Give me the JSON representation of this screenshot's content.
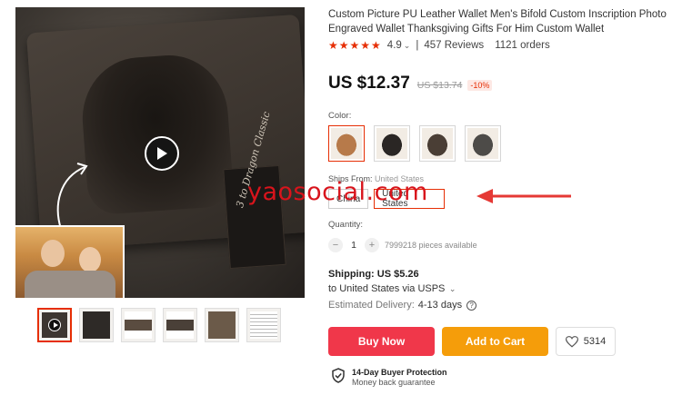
{
  "product": {
    "title": "Custom Picture PU Leather Wallet Men's Bifold Custom Inscription Photo Engraved Wallet Thanksgiving Gifts For Him Custom Wallet",
    "stars": "★★★★★",
    "rating": "4.9",
    "reviews": "457 Reviews",
    "orders": "1121 orders",
    "price": "US $12.37",
    "old_price": "US $13.74",
    "discount": "-10%"
  },
  "gallery": {
    "wallet_tag_text": "3 to Dragon Classic",
    "thumbnails": [
      "video",
      "black-wallet",
      "open-wallet",
      "open-wallet-2",
      "wallet-cash",
      "size-chart"
    ]
  },
  "color": {
    "label": "Color:",
    "options": [
      "brown",
      "black",
      "dark-brown",
      "grey"
    ]
  },
  "ships_from": {
    "label": "Ships From:",
    "value": "United States",
    "options": [
      "China",
      "United States"
    ]
  },
  "watermark": "yaosocial.com",
  "quantity": {
    "label": "Quantity:",
    "value": "1",
    "minus": "−",
    "plus": "+",
    "available": "7999218 pieces available"
  },
  "shipping": {
    "title": "Shipping: US $5.26",
    "destination": "to United States via USPS",
    "delivery_label": "Estimated Delivery:",
    "delivery_days": "4-13 days"
  },
  "actions": {
    "buy_now": "Buy Now",
    "add_to_cart": "Add to Cart",
    "wishlist_count": "5314"
  },
  "protection": {
    "title": "14-Day Buyer Protection",
    "subtitle": "Money back guarantee"
  },
  "colors": {
    "accent": "#e62e04",
    "buy_now": "#f0374a",
    "add_to_cart": "#f59d0a"
  }
}
